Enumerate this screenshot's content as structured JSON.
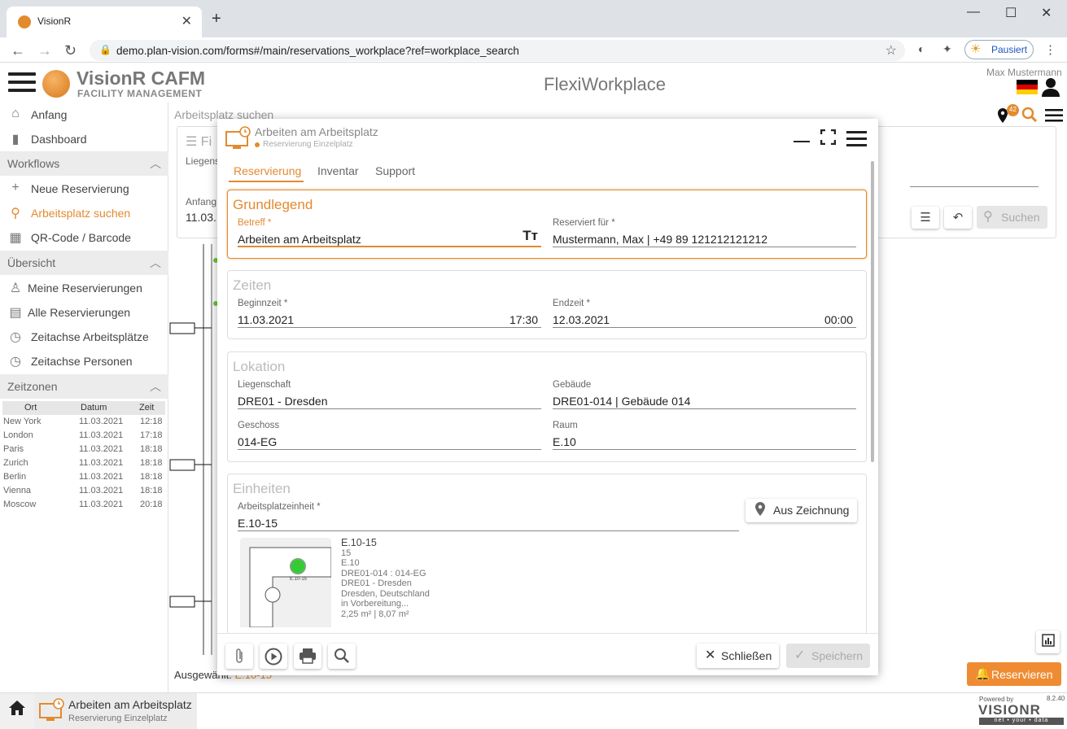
{
  "browser": {
    "tab_title": "VisionR",
    "url": "demo.plan-vision.com/forms#/main/reservations_workplace?ref=workplace_search",
    "profile_label": "Pausiert"
  },
  "header": {
    "brand_name": "VisionR CAFM",
    "brand_sub": "FACILITY MANAGEMENT",
    "app_title": "FlexiWorkplace",
    "user_name": "Max Mustermann"
  },
  "sidebar": {
    "items_top": [
      {
        "label": "Anfang",
        "icon": "home-icon"
      },
      {
        "label": "Dashboard",
        "icon": "bar-chart-icon"
      }
    ],
    "workflows_title": "Workflows",
    "workflows": [
      {
        "label": "Neue Reservierung",
        "icon": "plus-icon"
      },
      {
        "label": "Arbeitsplatz suchen",
        "icon": "search-icon"
      },
      {
        "label": "QR-Code / Barcode",
        "icon": "qr-code-icon"
      }
    ],
    "overview_title": "Übersicht",
    "overview": [
      {
        "label": "Meine Reservierungen",
        "icon": "person-icon"
      },
      {
        "label": "Alle Reservierungen",
        "icon": "calendar-icon"
      },
      {
        "label": "Zeitachse Arbeitsplätze",
        "icon": "clock-icon"
      },
      {
        "label": "Zeitachse Personen",
        "icon": "clock-icon"
      }
    ],
    "timezones_title": "Zeitzonen",
    "timezone_headers": [
      "Ort",
      "Datum",
      "Zeit"
    ],
    "timezones": [
      {
        "ort": "New York",
        "datum": "11.03.2021",
        "zeit": "12:18"
      },
      {
        "ort": "London",
        "datum": "11.03.2021",
        "zeit": "17:18"
      },
      {
        "ort": "Paris",
        "datum": "11.03.2021",
        "zeit": "18:18"
      },
      {
        "ort": "Zurich",
        "datum": "11.03.2021",
        "zeit": "18:18"
      },
      {
        "ort": "Berlin",
        "datum": "11.03.2021",
        "zeit": "18:18"
      },
      {
        "ort": "Vienna",
        "datum": "11.03.2021",
        "zeit": "18:18"
      },
      {
        "ort": "Moscow",
        "datum": "11.03.2021",
        "zeit": "20:18"
      }
    ]
  },
  "background": {
    "page_title": "Arbeitsplatz suchen",
    "filter_label": "Fi",
    "liegens_label": "Liegens",
    "anfang_label": "Anfang",
    "anfang_value": "11.03.",
    "search_label": "Suchen",
    "notification_count": "42",
    "selected_label": "Ausgewählt:",
    "selected_value": "E.10-15",
    "reserve_label": "Reservieren"
  },
  "modal": {
    "title": "Arbeiten am Arbeitsplatz",
    "subtitle": "Reservierung Einzelplatz",
    "tabs": [
      "Reservierung",
      "Inventar",
      "Support"
    ],
    "grundlegend": {
      "title": "Grundlegend",
      "betreff_label": "Betreff *",
      "betreff_value": "Arbeiten am Arbeitsplatz",
      "reserviert_label": "Reserviert für *",
      "reserviert_value": "Mustermann, Max | +49 89 121212121212"
    },
    "zeiten": {
      "title": "Zeiten",
      "begin_label": "Beginnzeit *",
      "begin_date": "11.03.2021",
      "begin_time": "17:30",
      "end_label": "Endzeit *",
      "end_date": "12.03.2021",
      "end_time": "00:00"
    },
    "lokation": {
      "title": "Lokation",
      "liegenschaft_label": "Liegenschaft",
      "liegenschaft_value": "DRE01 - Dresden",
      "gebaeude_label": "Gebäude",
      "gebaeude_value": "DRE01-014 | Gebäude 014",
      "geschoss_label": "Geschoss",
      "geschoss_value": "014-EG",
      "raum_label": "Raum",
      "raum_value": "E.10"
    },
    "einheiten": {
      "title": "Einheiten",
      "unit_label": "Arbeitsplatzeinheit *",
      "unit_value": "E.10-15",
      "from_drawing_label": "Aus Zeichnung",
      "thumb_label": "E.10-15",
      "info": [
        "E.10-15",
        "15",
        "E.10",
        "DRE01-014 : 014-EG",
        "DRE01 - Dresden",
        "Dresden, Deutschland",
        "in Vorbereitung...",
        "2,25 m² | 8,07 m²"
      ]
    },
    "close_label": "Schließen",
    "save_label": "Speichern"
  },
  "taskbar": {
    "title": "Arbeiten am Arbeitsplatz",
    "subtitle": "Reservierung Einzelplatz",
    "powered": "Powered by",
    "version": "8.2.40",
    "logo_text": "VISIONR",
    "logo_tagline": "net • your • data"
  },
  "colors": {
    "accent": "#e38a2f",
    "reserve": "#ef8c33"
  }
}
